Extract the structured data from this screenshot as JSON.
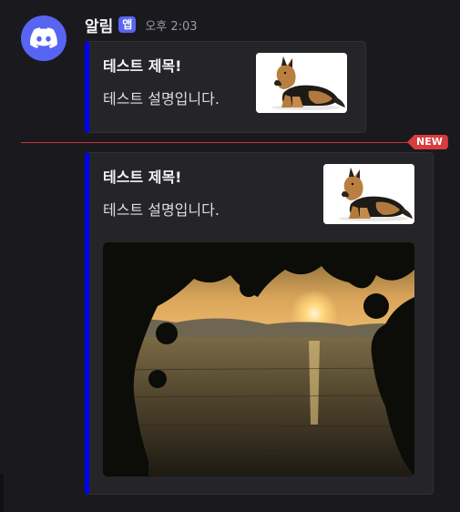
{
  "message": {
    "author": "알림",
    "badge": "앱",
    "timestamp": "오후 2:03"
  },
  "divider": {
    "new_label": "NEW"
  },
  "embeds": [
    {
      "title": "테스트 제목!",
      "description": "테스트 설명입니다.",
      "accent_color": "#0000ff",
      "thumbnail": "german-shepherd-dog"
    },
    {
      "title": "테스트 제목!",
      "description": "테스트 설명입니다.",
      "accent_color": "#0000ff",
      "thumbnail": "german-shepherd-dog",
      "image": "sunset-over-lake"
    }
  ],
  "colors": {
    "background": "#1a1a1e",
    "embed_bg": "#242429",
    "brand": "#5865f2",
    "new_red": "#d83c3e"
  }
}
